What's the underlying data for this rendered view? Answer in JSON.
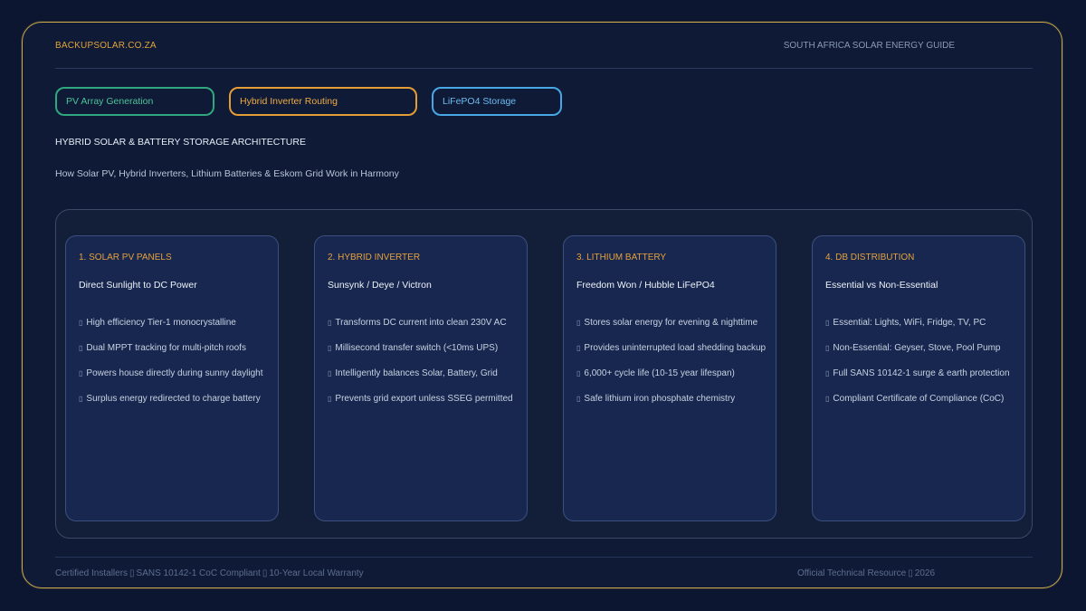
{
  "header": {
    "brand": "BACKUPSOLAR.CO.ZA",
    "guide": "SOUTH AFRICA SOLAR ENERGY GUIDE"
  },
  "chips": [
    {
      "label": "PV Array Generation"
    },
    {
      "label": "Hybrid Inverter Routing"
    },
    {
      "label": "LiFePO4 Storage"
    }
  ],
  "intro": {
    "title": "HYBRID SOLAR & BATTERY STORAGE ARCHITECTURE",
    "subtitle": "How Solar PV, Hybrid Inverters, Lithium Batteries & Eskom Grid Work in Harmony"
  },
  "cards": [
    {
      "heading": "1. SOLAR PV PANELS",
      "subheading": "Direct Sunlight to DC Power",
      "items": [
        "High efficiency Tier-1 monocrystalline",
        "Dual MPPT tracking for multi-pitch roofs",
        "Powers house directly during sunny daylight",
        "Surplus energy redirected to charge battery"
      ]
    },
    {
      "heading": "2. HYBRID INVERTER",
      "subheading": "Sunsynk / Deye / Victron",
      "items": [
        "Transforms DC current into clean 230V AC",
        "Millisecond transfer switch (<10ms UPS)",
        "Intelligently balances Solar, Battery, Grid",
        "Prevents grid export unless SSEG permitted"
      ]
    },
    {
      "heading": "3. LITHIUM BATTERY",
      "subheading": "Freedom Won / Hubble LiFePO4",
      "items": [
        "Stores solar energy for evening & nighttime",
        "Provides uninterrupted load shedding backup",
        "6,000+ cycle life (10-15 year lifespan)",
        "Safe lithium iron phosphate chemistry"
      ]
    },
    {
      "heading": "4. DB DISTRIBUTION",
      "subheading": "Essential vs Non-Essential",
      "items": [
        "Essential: Lights, WiFi, Fridge, TV, PC",
        "Non-Essential: Geyser, Stove, Pool Pump",
        "Full SANS 10142-1 surge & earth protection",
        "Compliant Certificate of Compliance (CoC)"
      ]
    }
  ],
  "footer": {
    "left": [
      "Certified Installers",
      "SANS 10142-1 CoC Compliant",
      "10-Year Local Warranty"
    ],
    "right": [
      "Official Technical Resource",
      "2026"
    ]
  },
  "colors": {
    "accent_gold": "#e0a43a",
    "pv_green": "#2fa77f",
    "inverter_orange": "#e39d34",
    "storage_blue": "#48a8e6",
    "background": "#0c1630"
  }
}
